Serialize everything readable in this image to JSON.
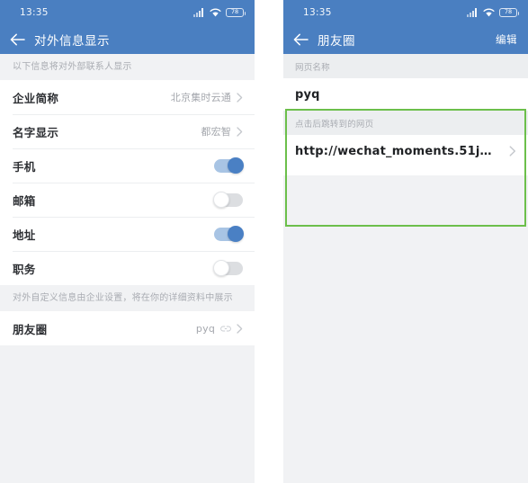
{
  "left_phone": {
    "status_bar": {
      "time": "13:35",
      "battery_level": "78",
      "icons": [
        "signal-icon",
        "wifi-icon",
        "battery-icon"
      ]
    },
    "title_bar": {
      "back_icon": "back-arrow-icon",
      "title": "对外信息显示"
    },
    "section_note": "以下信息将对外部联系人显示",
    "rows": [
      {
        "label": "企业简称",
        "value": "北京集时云通",
        "type": "nav"
      },
      {
        "label": "名字显示",
        "value": "都宏智",
        "type": "nav"
      },
      {
        "label": "手机",
        "type": "toggle",
        "state": "on"
      },
      {
        "label": "邮箱",
        "type": "toggle",
        "state": "off"
      },
      {
        "label": "地址",
        "type": "toggle",
        "state": "on"
      },
      {
        "label": "职务",
        "type": "toggle",
        "state": "off"
      }
    ],
    "section_note_2": "对外自定义信息由企业设置，将在你的详细资料中展示",
    "custom_rows": [
      {
        "label": "朋友圈",
        "value": "pyq",
        "type": "link-nav"
      }
    ]
  },
  "right_phone": {
    "status_bar": {
      "time": "13:35",
      "battery_level": "78",
      "icons": [
        "signal-icon",
        "wifi-icon",
        "battery-icon"
      ]
    },
    "title_bar": {
      "back_icon": "back-arrow-icon",
      "title": "朋友圈",
      "action_label": "编辑"
    },
    "fields": [
      {
        "header": "网页名称",
        "value": "pyq",
        "has_chevron": false
      },
      {
        "header": "点击后跳转到的网页",
        "value": "http://wechat_moments.51j…",
        "has_chevron": true
      }
    ]
  },
  "colors": {
    "header_blue": "#4a7fc1",
    "toggle_on": "#4a80c4",
    "toggle_on_track": "#a8c4e4",
    "highlight_green": "#6cbf4b",
    "page_bg": "#f1f2f4"
  }
}
